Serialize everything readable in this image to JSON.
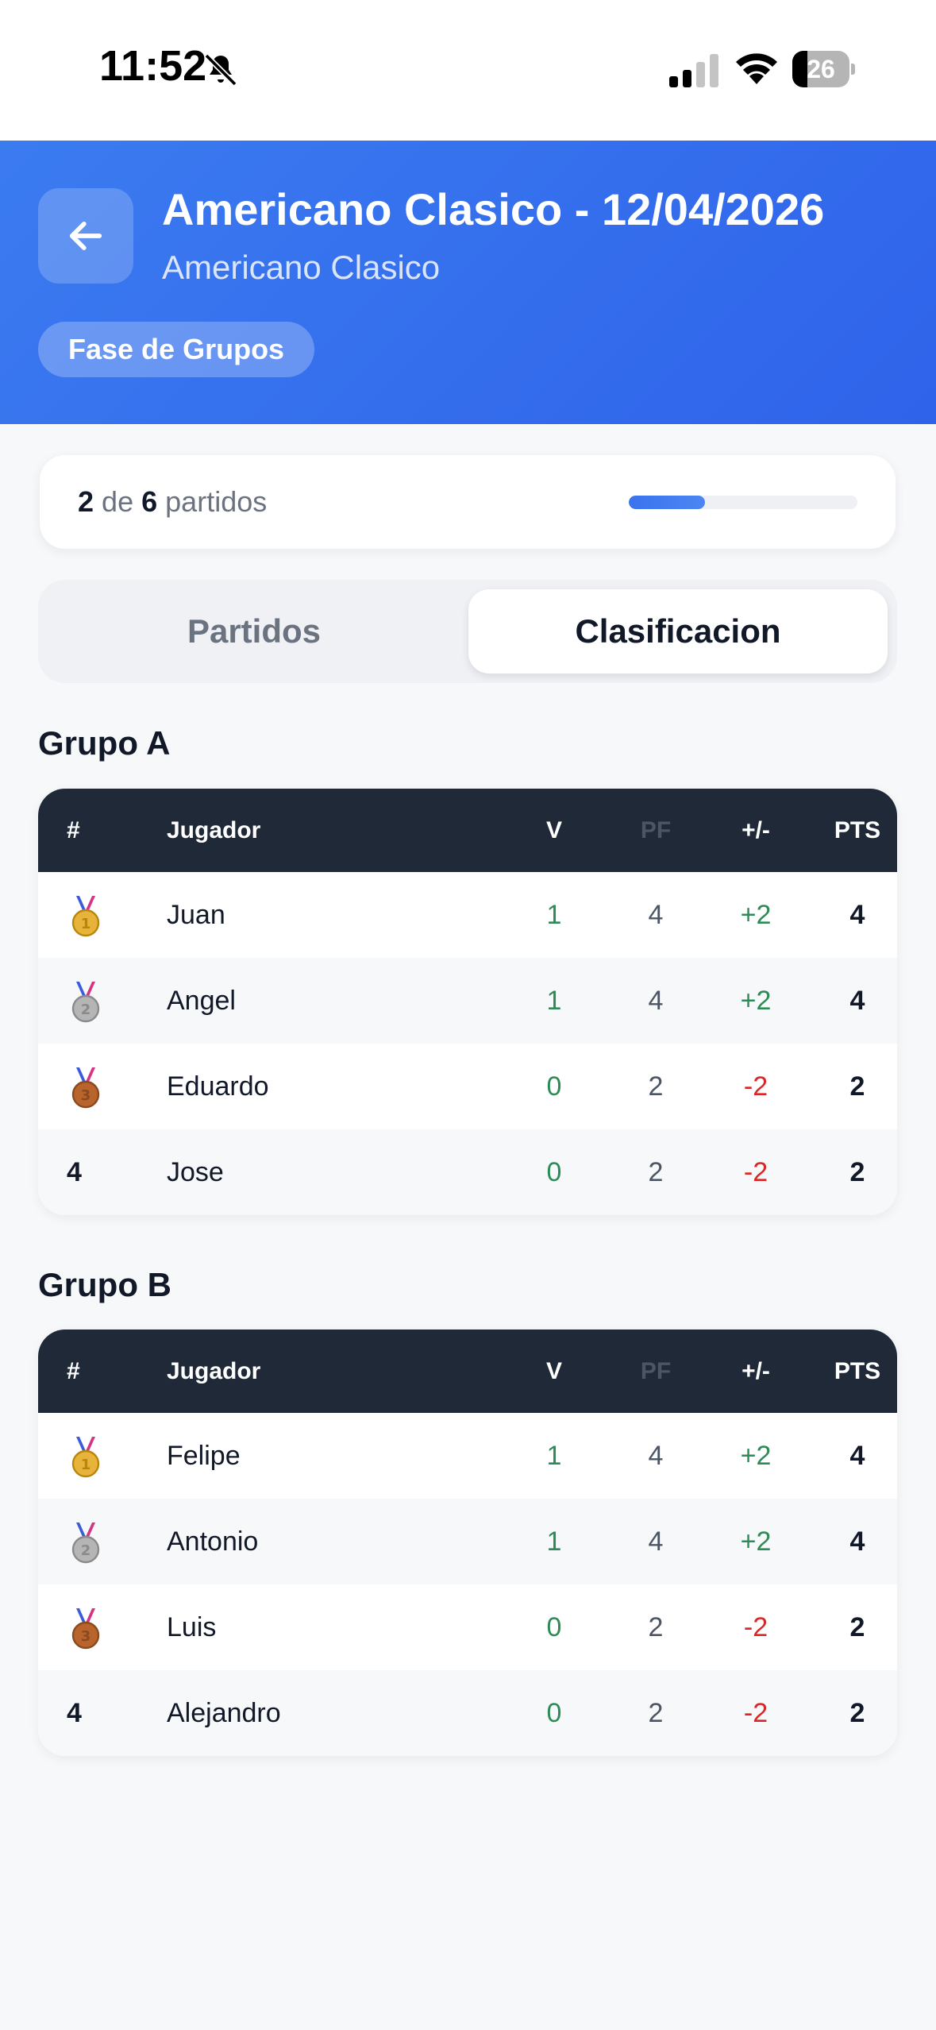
{
  "status": {
    "time": "11:52",
    "battery": "26",
    "battery_level": 0.26
  },
  "header": {
    "title": "Americano Clasico - 12/04/2026",
    "subtitle": "Americano Clasico",
    "phase": "Fase de Grupos"
  },
  "progress": {
    "played": "2",
    "connector": "de",
    "total": "6",
    "unit": "partidos",
    "fraction": 0.333
  },
  "tabs": {
    "partidos": "Partidos",
    "clasificacion": "Clasificacion",
    "selected": "clasificacion"
  },
  "columns": {
    "rank": "#",
    "player": "Jugador",
    "wins": "V",
    "points_for": "PF",
    "diff": "+/-",
    "points": "PTS"
  },
  "groups": [
    {
      "title": "Grupo A",
      "rows": [
        {
          "rank": "1",
          "medal": "gold",
          "player": "Juan",
          "wins": "1",
          "points_for": "4",
          "diff": "+2",
          "points": "4"
        },
        {
          "rank": "2",
          "medal": "silver",
          "player": "Angel",
          "wins": "1",
          "points_for": "4",
          "diff": "+2",
          "points": "4"
        },
        {
          "rank": "3",
          "medal": "bronze",
          "player": "Eduardo",
          "wins": "0",
          "points_for": "2",
          "diff": "-2",
          "points": "2"
        },
        {
          "rank": "4",
          "medal": "",
          "player": "Jose",
          "wins": "0",
          "points_for": "2",
          "diff": "-2",
          "points": "2"
        }
      ]
    },
    {
      "title": "Grupo B",
      "rows": [
        {
          "rank": "1",
          "medal": "gold",
          "player": "Felipe",
          "wins": "1",
          "points_for": "4",
          "diff": "+2",
          "points": "4"
        },
        {
          "rank": "2",
          "medal": "silver",
          "player": "Antonio",
          "wins": "1",
          "points_for": "4",
          "diff": "+2",
          "points": "4"
        },
        {
          "rank": "3",
          "medal": "bronze",
          "player": "Luis",
          "wins": "0",
          "points_for": "2",
          "diff": "-2",
          "points": "2"
        },
        {
          "rank": "4",
          "medal": "",
          "player": "Alejandro",
          "wins": "0",
          "points_for": "2",
          "diff": "-2",
          "points": "2"
        }
      ]
    }
  ],
  "colors": {
    "header_start": "#3b7bf0",
    "header_end": "#2f63ea",
    "table_header": "#1f2937",
    "positive": "#2e8b57",
    "negative": "#dc2626"
  },
  "icons": {
    "back": "arrow-left-icon",
    "silent": "bell-off-icon",
    "signal": "cellular-signal-icon",
    "wifi": "wifi-icon",
    "battery": "battery-icon",
    "medals": [
      "gold-medal-icon",
      "silver-medal-icon",
      "bronze-medal-icon"
    ]
  }
}
